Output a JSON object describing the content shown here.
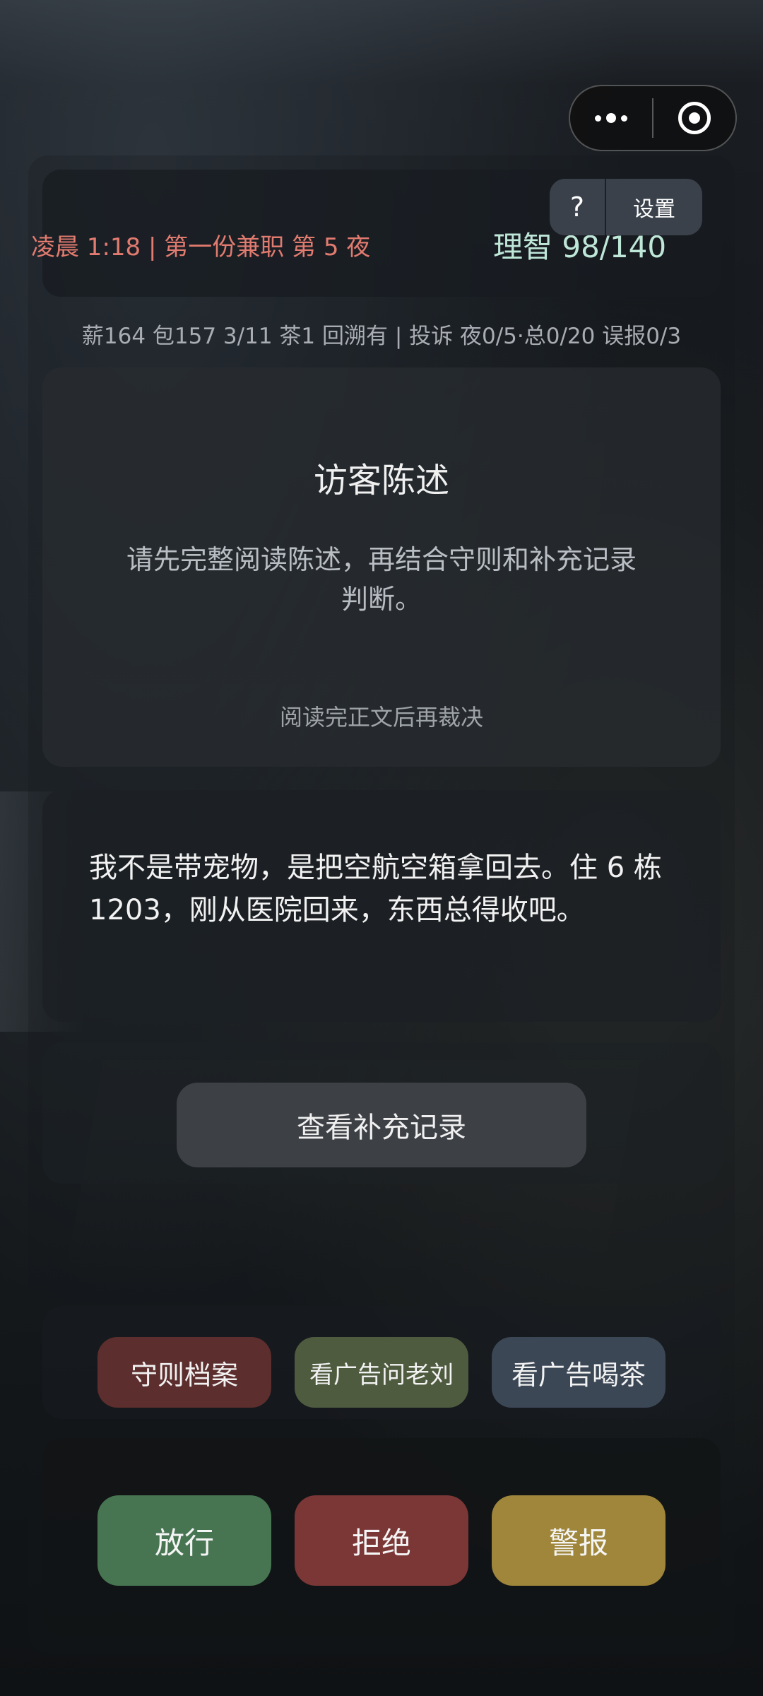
{
  "topbar": {
    "capsule": {
      "menu_icon": "more-dots-icon",
      "close_icon": "target-circle-icon"
    }
  },
  "status": {
    "time_line": "凌晨 1:18 | 第一份兼职 第 5 夜",
    "sanity": "理智 98/140",
    "help_label": "?",
    "settings_label": "设置",
    "time_color": "#e27b6f",
    "sanity_color": "#bfe7d8"
  },
  "stats_line": "薪164 包157 3/11 茶1 回溯有 | 投诉 夜0/5·总0/20 误报0/3",
  "statement": {
    "title": "访客陈述",
    "hint": "请先完整阅读陈述，再结合守则和补充记录判断。",
    "read_note": "阅读完正文后再裁决"
  },
  "dialogue": {
    "text": "我不是带宠物，是把空航空箱拿回去。住 6 栋 1203，刚从医院回来，东西总得收吧。"
  },
  "supplement": {
    "button_label": "查看补充记录"
  },
  "tools": {
    "rules_label": "守则档案",
    "ask_label": "看广告问老刘",
    "tea_label": "看广告喝茶",
    "colors": {
      "rules": "#5c2e2d",
      "ask": "#4f5b3f",
      "tea": "#3c4756"
    }
  },
  "decisions": {
    "pass_label": "放行",
    "reject_label": "拒绝",
    "alarm_label": "警报",
    "colors": {
      "pass": "#477552",
      "reject": "#7b3636",
      "alarm": "#9f863b"
    }
  }
}
